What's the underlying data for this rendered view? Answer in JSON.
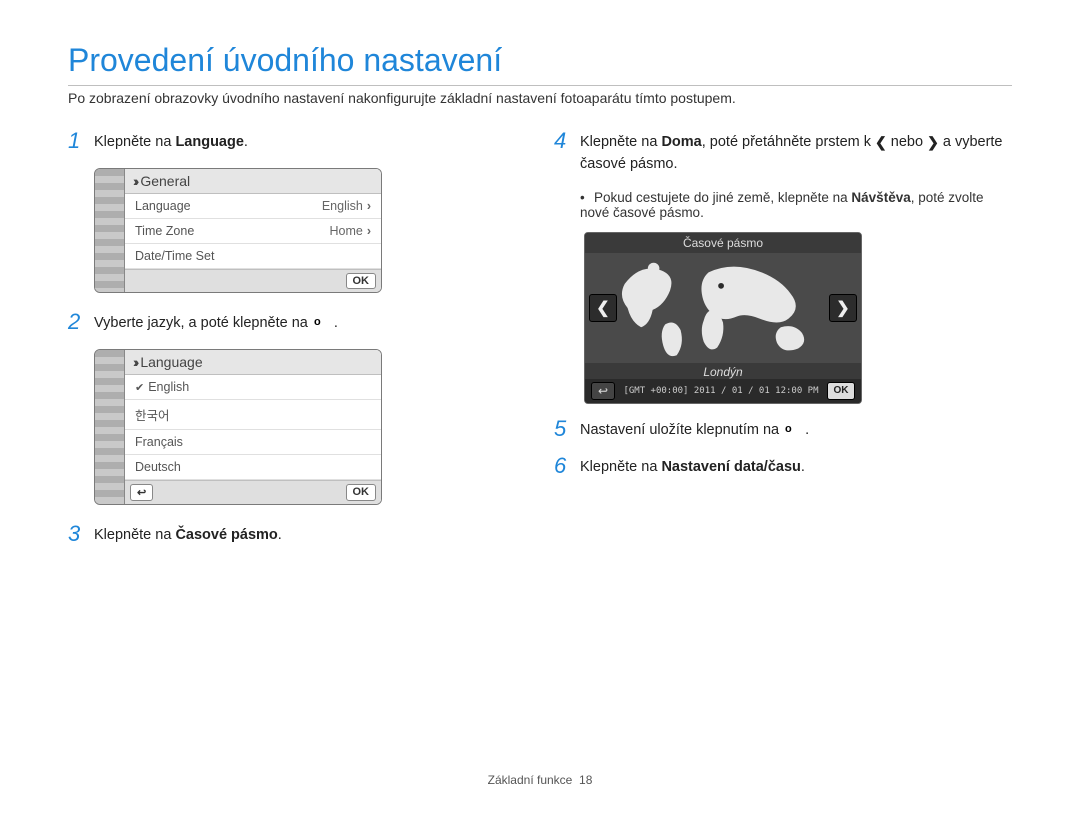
{
  "title": "Provedení úvodního nastavení",
  "intro": "Po zobrazení obrazovky úvodního nastavení nakonfigurujte základní nastavení fotoaparátu tímto postupem.",
  "steps": {
    "s1": {
      "num": "1",
      "pre": "Klepněte na ",
      "bold": "Language",
      "post": "."
    },
    "s2": {
      "num": "2",
      "pre": "Vyberte jazyk, a poté klepněte na ",
      "ok": "o",
      "post": "."
    },
    "s3": {
      "num": "3",
      "pre": "Klepněte na ",
      "bold": "Časové pásmo",
      "post": "."
    },
    "s4": {
      "num": "4",
      "pre": "Klepněte na ",
      "bold": "Doma",
      "mid": ", poté přetáhněte prstem k ",
      "or": " nebo ",
      "post2": " a vyberte časové pásmo."
    },
    "s4sub": {
      "pre": "Pokud cestujete do jiné země, klepněte na ",
      "bold": "Návštěva",
      "post": ", poté zvolte nové časové pásmo."
    },
    "s5": {
      "num": "5",
      "pre": "Nastavení uložíte klepnutím na ",
      "ok": "o",
      "post": "."
    },
    "s6": {
      "num": "6",
      "pre": "Klepněte na ",
      "bold": "Nastavení data/času",
      "post": "."
    }
  },
  "device_general": {
    "header": "General",
    "rows": [
      {
        "label": "Language",
        "value": "English"
      },
      {
        "label": "Time Zone",
        "value": "Home"
      },
      {
        "label": "Date/Time Set",
        "value": ""
      }
    ],
    "ok": "OK"
  },
  "device_language": {
    "header": "Language",
    "items": [
      "English",
      "한국어",
      "Français",
      "Deutsch"
    ],
    "selected_index": 0,
    "back": "↩",
    "ok": "OK"
  },
  "device_timezone": {
    "header": "Časové pásmo",
    "city": "Londýn",
    "datetime": "[GMT +00:00]  2011 / 01 / 01  12:00 PM",
    "ok": "OK"
  },
  "footer": {
    "section": "Základní funkce",
    "page": "18"
  },
  "glyphs": {
    "ok": "o",
    "left": "❮",
    "right": "❯",
    "back": "↩"
  }
}
